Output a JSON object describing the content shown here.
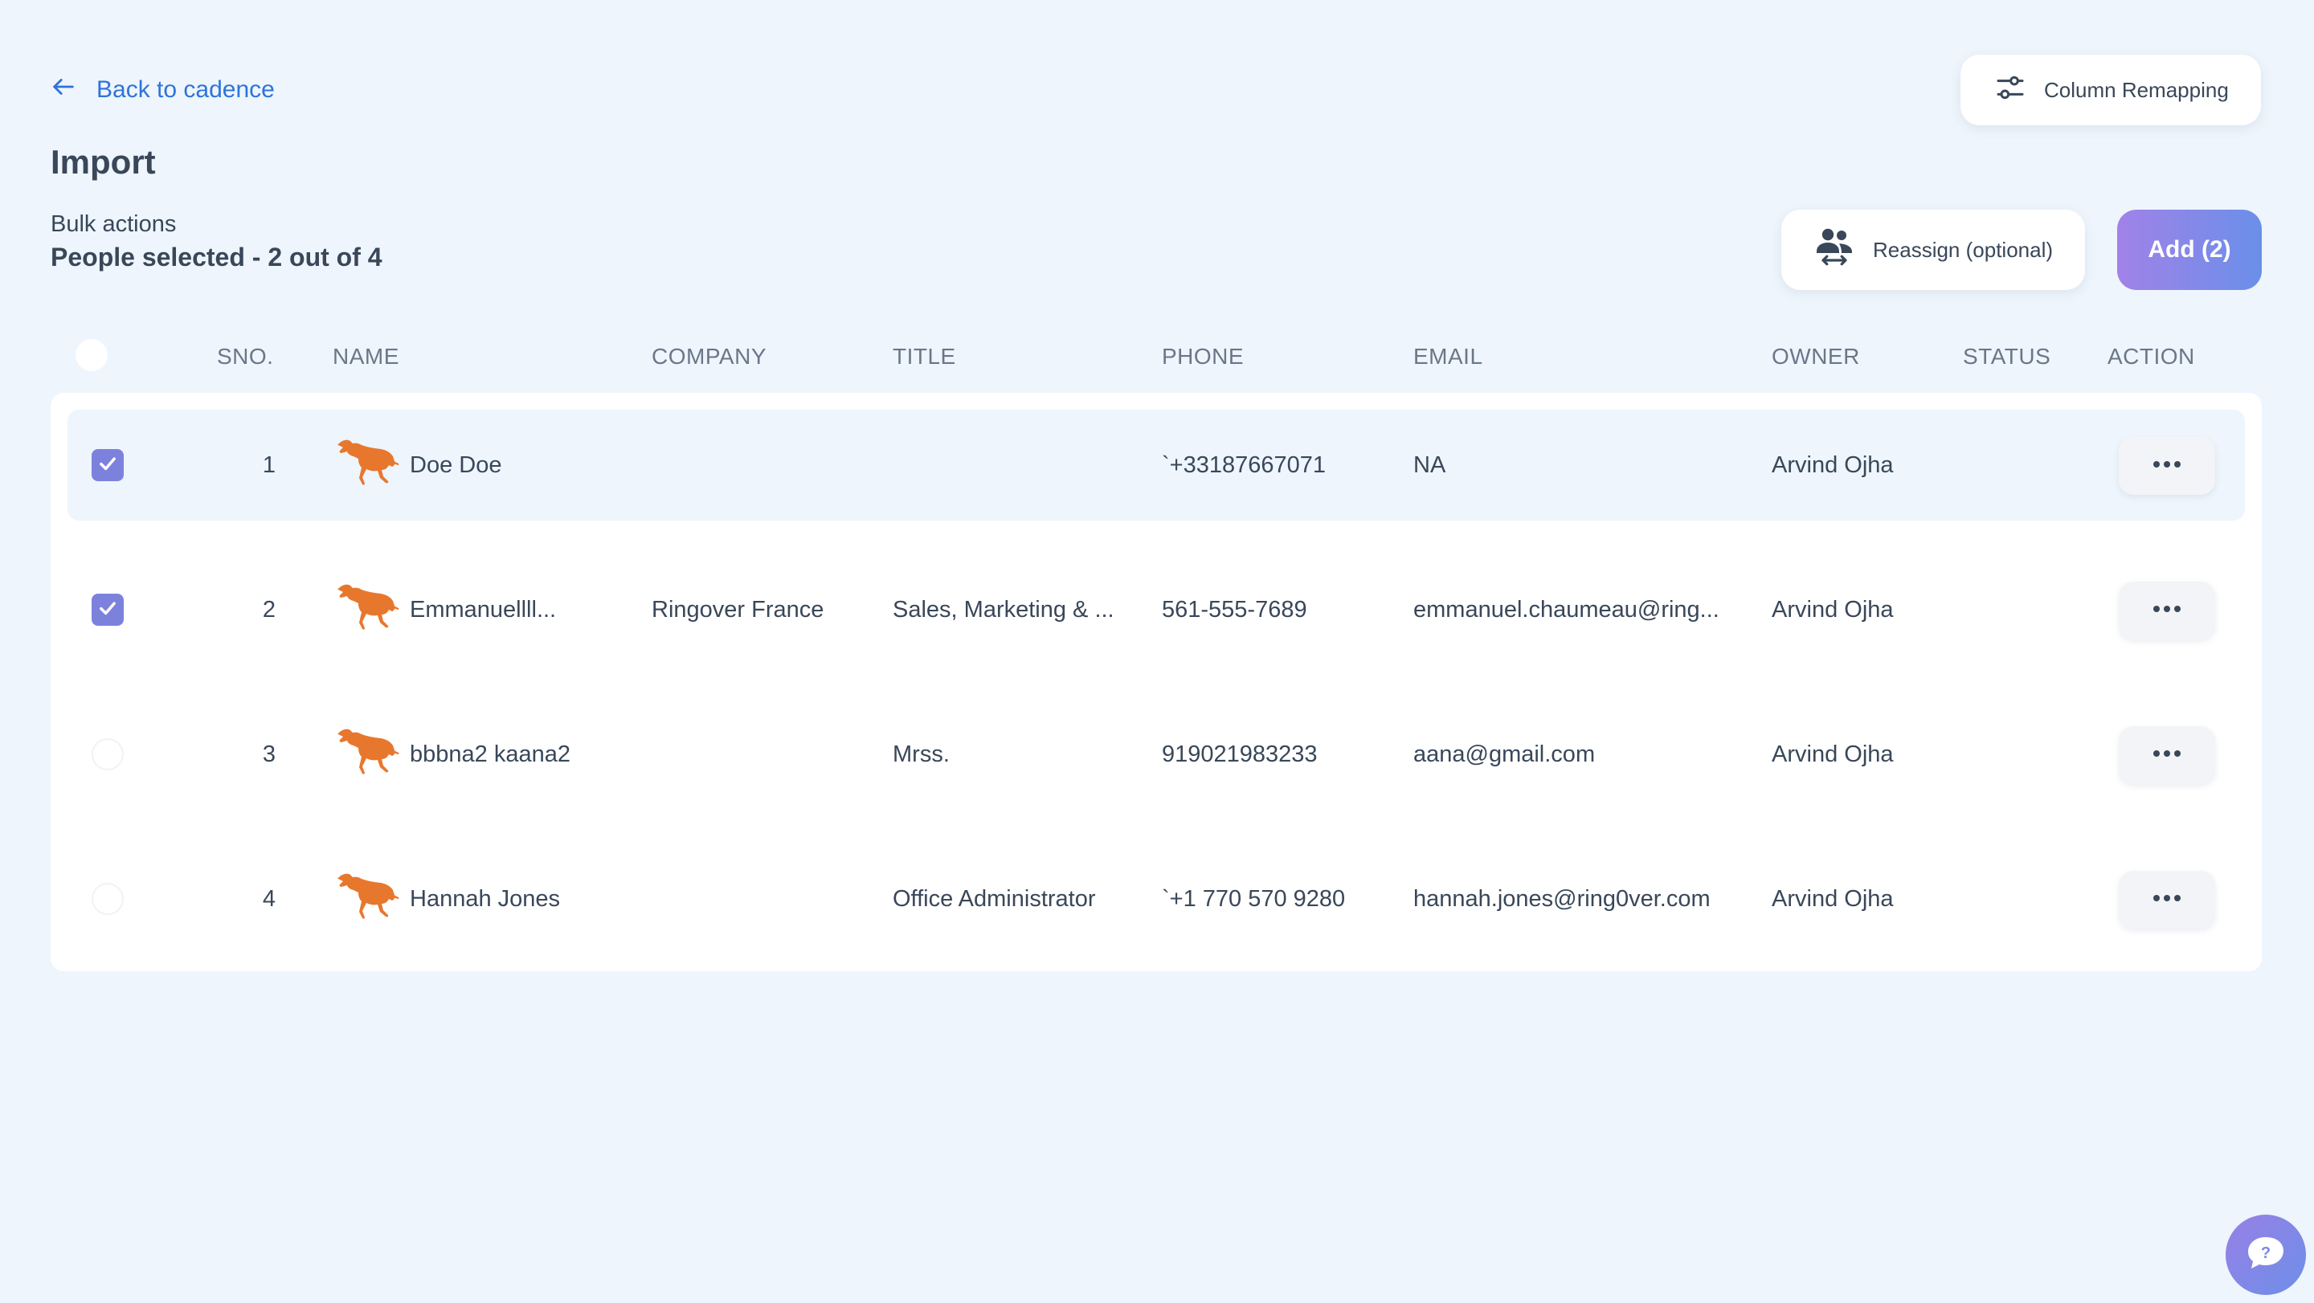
{
  "nav": {
    "back_label": "Back to cadence"
  },
  "header": {
    "column_remapping_label": "Column Remapping"
  },
  "page": {
    "title": "Import"
  },
  "bulk": {
    "label": "Bulk actions",
    "selected_text": "People selected - 2 out of 4",
    "reassign_label": "Reassign (optional)",
    "add_label": "Add (2)"
  },
  "table": {
    "columns": [
      "SNO.",
      "NAME",
      "COMPANY",
      "TITLE",
      "PHONE",
      "EMAIL",
      "OWNER",
      "STATUS",
      "ACTION"
    ],
    "rows": [
      {
        "sno": "1",
        "name": "Doe Doe",
        "company": "",
        "title": "",
        "phone": "`+33187667071",
        "email": "NA",
        "owner": "Arvind Ojha",
        "status": "",
        "checked": true,
        "highlighted": true
      },
      {
        "sno": "2",
        "name": "Emmanuellll...",
        "company": "Ringover France",
        "title": "Sales, Marketing & ...",
        "phone": "561-555-7689",
        "email": "emmanuel.chaumeau@ring...",
        "owner": "Arvind Ojha",
        "status": "",
        "checked": true,
        "highlighted": false
      },
      {
        "sno": "3",
        "name": "bbbna2 kaana2",
        "company": "",
        "title": "Mrss.",
        "phone": "919021983233",
        "email": "aana@gmail.com",
        "owner": "Arvind Ojha",
        "status": "",
        "checked": false,
        "highlighted": false
      },
      {
        "sno": "4",
        "name": "Hannah Jones",
        "company": "",
        "title": "Office Administrator",
        "phone": "`+1 770 570 9280",
        "email": "hannah.jones@ring0ver.com",
        "owner": "Arvind Ojha",
        "status": "",
        "checked": false,
        "highlighted": false
      }
    ]
  },
  "icons": {
    "back": "arrow-left-icon",
    "column_remapping": "sliders-icon",
    "reassign": "users-swap-icon",
    "avatar": "bull-logo-icon",
    "action": "more-dots-icon",
    "help": "help-chat-icon"
  },
  "colors": {
    "background": "#EEF5FC",
    "link": "#2E74D9",
    "text": "#394759",
    "header_text": "#6B7788",
    "checkbox_on": "#7C82DC",
    "add_gradient_start": "#A182E8",
    "add_gradient_end": "#6A8FE9",
    "avatar": "#E8772E"
  }
}
